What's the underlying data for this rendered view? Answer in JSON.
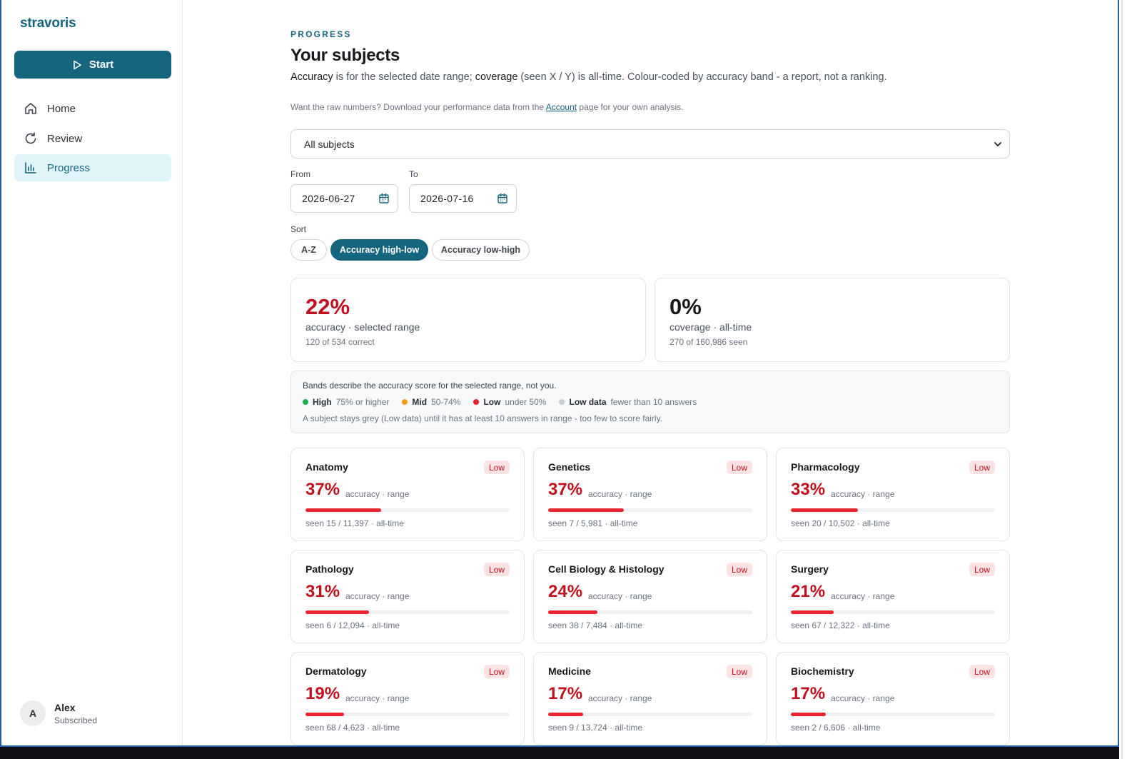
{
  "app": {
    "brand": "stravoris"
  },
  "sidebar": {
    "start_label": "Start",
    "items": [
      {
        "label": "Home",
        "icon": "home-icon"
      },
      {
        "label": "Review",
        "icon": "refresh-icon"
      },
      {
        "label": "Progress",
        "icon": "bar-chart-icon",
        "active": true
      }
    ],
    "user": {
      "initial": "A",
      "name": "Alex",
      "status": "Subscribed"
    }
  },
  "header": {
    "eyebrow": "PROGRESS",
    "title": "Your subjects",
    "desc_accuracy": "Accuracy",
    "desc_middle": " is for the selected date range; ",
    "desc_coverage": "coverage",
    "desc_end": " (seen X / Y) is all-time. Colour-coded by accuracy band - a report, not a ranking.",
    "note_pre": "Want the raw numbers? Download your performance data from the ",
    "note_link": "Account",
    "note_post": " page for your own analysis."
  },
  "filters": {
    "subject_select": "All subjects",
    "from_label": "From",
    "from_value": "2026-06-27",
    "to_label": "To",
    "to_value": "2026-07-16",
    "sort_label": "Sort",
    "sort_options": [
      "A-Z",
      "Accuracy high-low",
      "Accuracy low-high"
    ],
    "sort_selected": "Accuracy high-low"
  },
  "stats": {
    "accuracy": {
      "value": "22%",
      "label": "accuracy · selected range",
      "sub": "120 of 534 correct"
    },
    "coverage": {
      "value": "0%",
      "label": "coverage · all-time",
      "sub": "270 of 160,986 seen"
    }
  },
  "bands": {
    "head": "Bands describe the accuracy score for the selected range, not you.",
    "items": [
      {
        "name": "High",
        "desc": "75% or higher",
        "color": "#1fb04d"
      },
      {
        "name": "Mid",
        "desc": "50-74%",
        "color": "#f39c12"
      },
      {
        "name": "Low",
        "desc": "under 50%",
        "color": "#e8222f"
      },
      {
        "name": "Low data",
        "desc": "fewer than 10 answers",
        "color": "#c8ccd1"
      }
    ],
    "foot": "A subject stays grey (Low data) until it has at least 10 answers in range - too few to score fairly."
  },
  "cards_common": {
    "pct_label": "accuracy · range",
    "badge": "Low"
  },
  "subjects": [
    {
      "name": "Anatomy",
      "pct": "37%",
      "accuracy": 0.37,
      "seen": "seen 15 / 11,397 · all-time"
    },
    {
      "name": "Genetics",
      "pct": "37%",
      "accuracy": 0.37,
      "seen": "seen 7 / 5,981 · all-time"
    },
    {
      "name": "Pharmacology",
      "pct": "33%",
      "accuracy": 0.33,
      "seen": "seen 20 / 10,502 · all-time"
    },
    {
      "name": "Pathology",
      "pct": "31%",
      "accuracy": 0.31,
      "seen": "seen 6 / 12,094 · all-time"
    },
    {
      "name": "Cell Biology & Histology",
      "pct": "24%",
      "accuracy": 0.24,
      "seen": "seen 38 / 7,484 · all-time"
    },
    {
      "name": "Surgery",
      "pct": "21%",
      "accuracy": 0.21,
      "seen": "seen 67 / 12,322 · all-time"
    },
    {
      "name": "Dermatology",
      "pct": "19%",
      "accuracy": 0.19,
      "seen": "seen 68 / 4,623 · all-time"
    },
    {
      "name": "Medicine",
      "pct": "17%",
      "accuracy": 0.17,
      "seen": "seen 9 / 13,724 · all-time"
    },
    {
      "name": "Biochemistry",
      "pct": "17%",
      "accuracy": 0.17,
      "seen": "seen 2 / 6,606 · all-time"
    }
  ],
  "colors": {
    "accent": "#16657f",
    "low": "#c0101e",
    "low_bar": "#e8222f",
    "low_badge_bg": "#fde2e4"
  }
}
